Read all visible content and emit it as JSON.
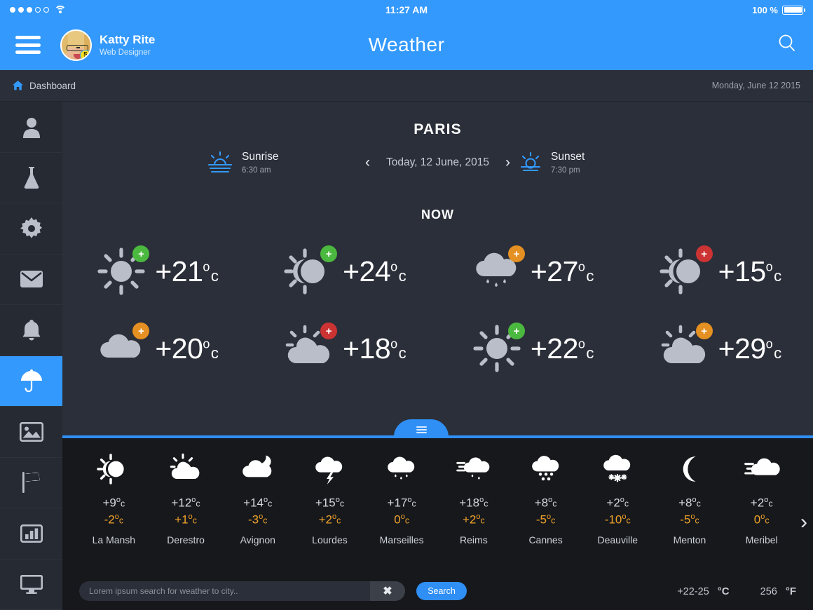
{
  "statusbar": {
    "time": "11:27 AM",
    "battery_percent": "100 %",
    "signal_icon": "signal-dots-icon",
    "wifi_icon": "wifi-icon",
    "battery_icon": "battery-icon"
  },
  "header": {
    "title": "Weather",
    "menu_icon": "hamburger-menu-icon",
    "search_icon": "search-icon",
    "user": {
      "name": "Katty Rite",
      "role": "Web Designer",
      "badge_count": "5",
      "avatar_icon": "avatar"
    }
  },
  "breadcrumb": {
    "home_icon": "home-icon",
    "label": "Dashboard",
    "date": "Monday, June 12 2015"
  },
  "sidebar": {
    "items": [
      {
        "name": "user",
        "icon": "user-icon",
        "active": false
      },
      {
        "name": "lab",
        "icon": "flask-icon",
        "active": false
      },
      {
        "name": "settings",
        "icon": "gear-icon",
        "active": false
      },
      {
        "name": "mail",
        "icon": "envelope-icon",
        "active": false
      },
      {
        "name": "alerts",
        "icon": "bell-icon",
        "active": false
      },
      {
        "name": "weather",
        "icon": "umbrella-icon",
        "active": true
      },
      {
        "name": "gallery",
        "icon": "image-icon",
        "active": false
      },
      {
        "name": "flags",
        "icon": "flag-icon",
        "active": false
      },
      {
        "name": "reports",
        "icon": "bar-chart-icon",
        "active": false
      },
      {
        "name": "display",
        "icon": "monitor-icon",
        "active": false
      }
    ]
  },
  "main": {
    "city": "PARIS",
    "sunrise": {
      "label": "Sunrise",
      "time": "6:30 am",
      "icon": "sunrise-icon"
    },
    "sunset": {
      "label": "Sunset",
      "time": "7:30 pm",
      "icon": "sunset-icon"
    },
    "date_nav": {
      "prev_icon": "chevron-left-icon",
      "label": "Today, 12 June, 2015",
      "next_icon": "chevron-right-icon"
    },
    "now_title": "NOW",
    "now_cards": [
      {
        "icon": "sun-icon",
        "temp": "+21",
        "deg": "o",
        "unit": "c",
        "badge": "+",
        "badge_color": "#4bb83f"
      },
      {
        "icon": "sun-eclipse-icon",
        "temp": "+24",
        "deg": "o",
        "unit": "c",
        "badge": "+",
        "badge_color": "#4bb83f"
      },
      {
        "icon": "rain-cloud-icon",
        "temp": "+27",
        "deg": "o",
        "unit": "c",
        "badge": "+",
        "badge_color": "#e59022"
      },
      {
        "icon": "sun-eclipse-icon",
        "temp": "+15",
        "deg": "o",
        "unit": "c",
        "badge": "+",
        "badge_color": "#cc3333"
      },
      {
        "icon": "cloud-icon",
        "temp": "+20",
        "deg": "o",
        "unit": "c",
        "badge": "+",
        "badge_color": "#e59022"
      },
      {
        "icon": "sun-cloud-icon",
        "temp": "+18",
        "deg": "o",
        "unit": "c",
        "badge": "+",
        "badge_color": "#cc3333"
      },
      {
        "icon": "sun-icon",
        "temp": "+22",
        "deg": "o",
        "unit": "c",
        "badge": "+",
        "badge_color": "#4bb83f"
      },
      {
        "icon": "sun-cloud-icon",
        "temp": "+29",
        "deg": "o",
        "unit": "c",
        "badge": "+",
        "badge_color": "#e59022"
      }
    ]
  },
  "divider": {
    "handle_icon": "drag-handle-icon"
  },
  "bottom": {
    "cities": [
      {
        "name": "La Mansh",
        "icon": "sun-eclipse-icon",
        "high": "+9",
        "low": "-2",
        "deg": "o",
        "unit": "c"
      },
      {
        "name": "Derestro",
        "icon": "sun-cloud-icon",
        "high": "+12",
        "low": "+1",
        "deg": "o",
        "unit": "c"
      },
      {
        "name": "Avignon",
        "icon": "moon-cloud-icon",
        "high": "+14",
        "low": "-3",
        "deg": "o",
        "unit": "c"
      },
      {
        "name": "Lourdes",
        "icon": "thunderstorm-icon",
        "high": "+15",
        "low": "+2",
        "deg": "o",
        "unit": "c"
      },
      {
        "name": "Marseilles",
        "icon": "rain-cloud-icon",
        "high": "+17",
        "low": "0",
        "deg": "o",
        "unit": "c"
      },
      {
        "name": "Reims",
        "icon": "windy-rain-icon",
        "high": "+18",
        "low": "+2",
        "deg": "o",
        "unit": "c"
      },
      {
        "name": "Cannes",
        "icon": "sleet-cloud-icon",
        "high": "+8",
        "low": "-5",
        "deg": "o",
        "unit": "c"
      },
      {
        "name": "Deauville",
        "icon": "snow-cloud-icon",
        "high": "+2",
        "low": "-10",
        "deg": "o",
        "unit": "c"
      },
      {
        "name": "Menton",
        "icon": "moon-icon",
        "high": "+8",
        "low": "-5",
        "deg": "o",
        "unit": "c"
      },
      {
        "name": "Meribel",
        "icon": "windy-cloud-icon",
        "high": "+2",
        "low": "0",
        "deg": "o",
        "unit": "c"
      }
    ],
    "next_icon": "chevron-right-icon",
    "search": {
      "placeholder": "Lorem ipsum search for weather to city..",
      "value": "",
      "clear_icon": "close-icon",
      "button_label": "Search"
    },
    "units": [
      {
        "value": "+22-25",
        "symbol": "°C"
      },
      {
        "value": "256",
        "symbol": "°F"
      }
    ]
  },
  "colors": {
    "accent": "#3399fd",
    "panel": "#2b2f39",
    "sidebar": "#262a33",
    "bottom": "#16181c",
    "low_temp": "#f0a22a"
  }
}
